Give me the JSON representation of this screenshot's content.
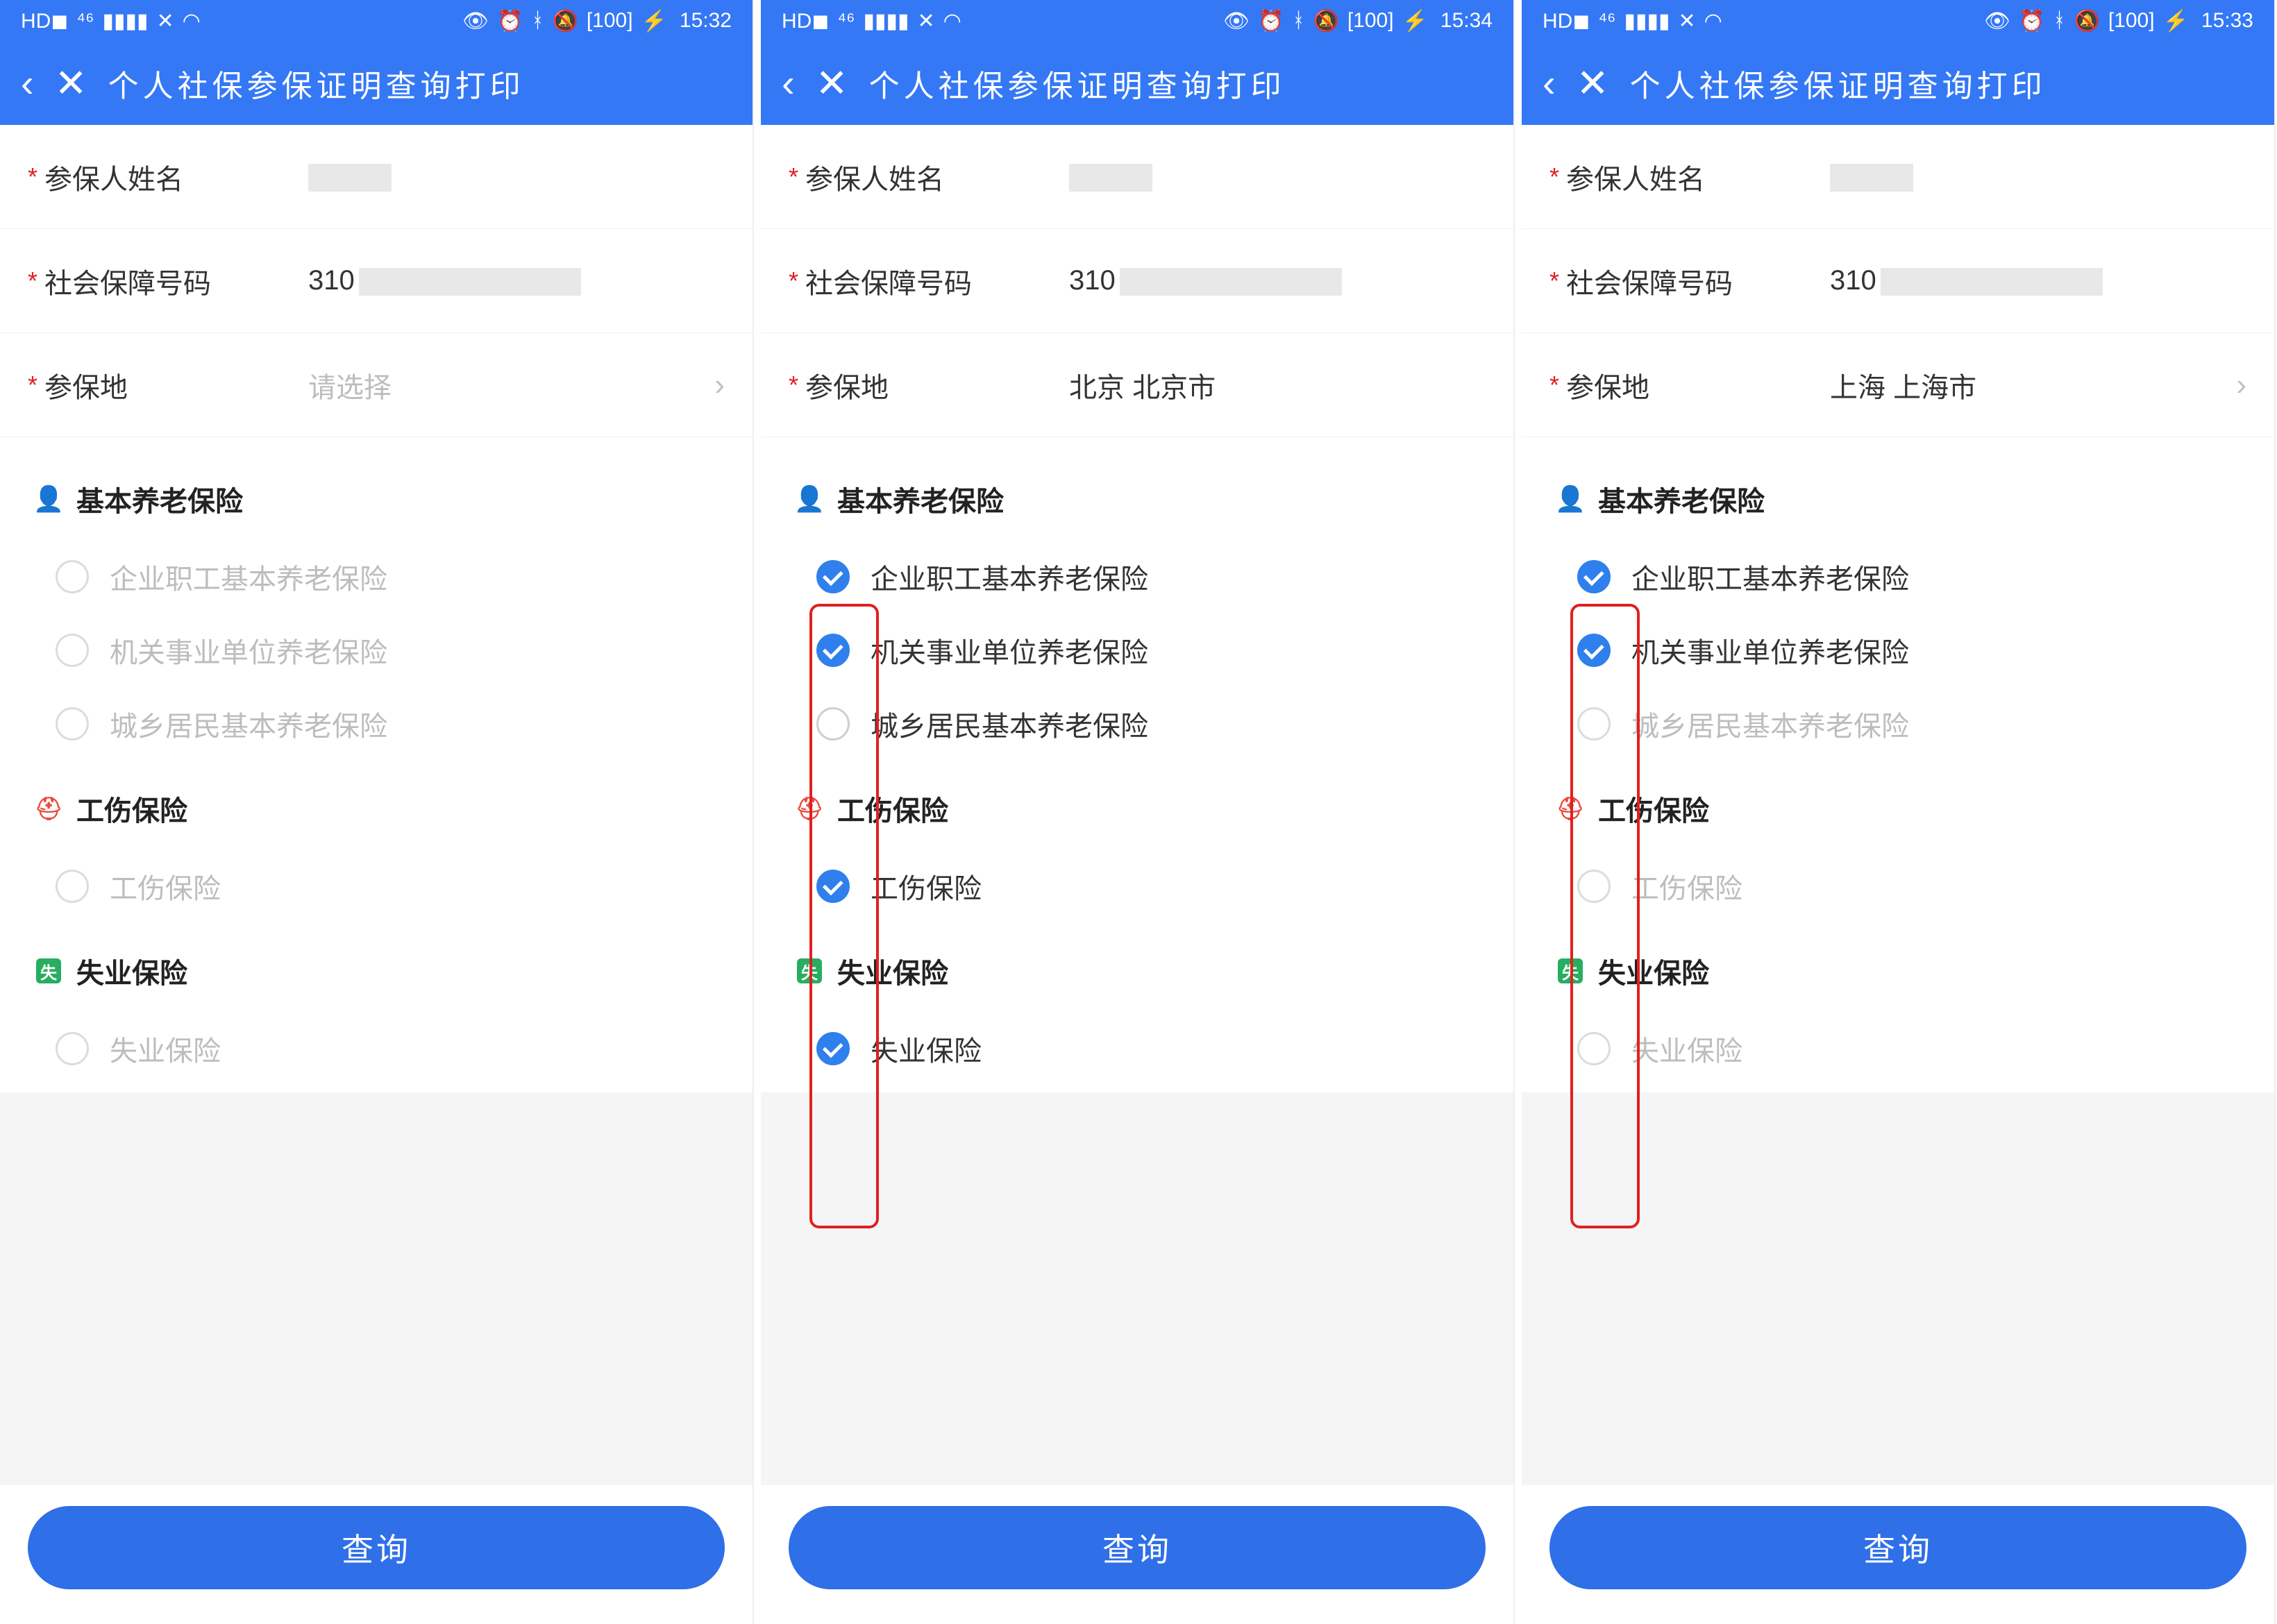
{
  "screens": [
    {
      "status": {
        "time": "15:32",
        "battery": "100"
      },
      "title": "个人社保参保证明查询打印",
      "form": {
        "name_label": "参保人姓名",
        "name_value": "",
        "ssn_label": "社会保障号码",
        "ssn_value": "310",
        "loc_label": "参保地",
        "loc_value": "请选择",
        "loc_is_placeholder": true,
        "show_chevron": true
      },
      "sections": {
        "pension": {
          "title": "基本养老保险",
          "options": [
            {
              "label": "企业职工基本养老保险",
              "checked": false,
              "disabled": true
            },
            {
              "label": "机关事业单位养老保险",
              "checked": false,
              "disabled": true
            },
            {
              "label": "城乡居民基本养老保险",
              "checked": false,
              "disabled": true
            }
          ]
        },
        "injury": {
          "title": "工伤保险",
          "options": [
            {
              "label": "工伤保险",
              "checked": false,
              "disabled": true
            }
          ]
        },
        "unemployment": {
          "title": "失业保险",
          "options": [
            {
              "label": "失业保险",
              "checked": false,
              "disabled": true
            }
          ]
        }
      },
      "button": "查询",
      "redbox": false
    },
    {
      "status": {
        "time": "15:34",
        "battery": "100"
      },
      "title": "个人社保参保证明查询打印",
      "form": {
        "name_label": "参保人姓名",
        "name_value": "",
        "ssn_label": "社会保障号码",
        "ssn_value": "310",
        "loc_label": "参保地",
        "loc_value": "北京 北京市",
        "loc_is_placeholder": false,
        "show_chevron": false
      },
      "sections": {
        "pension": {
          "title": "基本养老保险",
          "options": [
            {
              "label": "企业职工基本养老保险",
              "checked": true,
              "disabled": false
            },
            {
              "label": "机关事业单位养老保险",
              "checked": true,
              "disabled": false
            },
            {
              "label": "城乡居民基本养老保险",
              "checked": false,
              "disabled": false
            }
          ]
        },
        "injury": {
          "title": "工伤保险",
          "options": [
            {
              "label": "工伤保险",
              "checked": true,
              "disabled": false
            }
          ]
        },
        "unemployment": {
          "title": "失业保险",
          "options": [
            {
              "label": "失业保险",
              "checked": true,
              "disabled": false
            }
          ]
        }
      },
      "button": "查询",
      "redbox": true
    },
    {
      "status": {
        "time": "15:33",
        "battery": "100"
      },
      "title": "个人社保参保证明查询打印",
      "form": {
        "name_label": "参保人姓名",
        "name_value": "",
        "ssn_label": "社会保障号码",
        "ssn_value": "310",
        "loc_label": "参保地",
        "loc_value": "上海 上海市",
        "loc_is_placeholder": false,
        "show_chevron": true
      },
      "sections": {
        "pension": {
          "title": "基本养老保险",
          "options": [
            {
              "label": "企业职工基本养老保险",
              "checked": true,
              "disabled": false
            },
            {
              "label": "机关事业单位养老保险",
              "checked": true,
              "disabled": false
            },
            {
              "label": "城乡居民基本养老保险",
              "checked": false,
              "disabled": true
            }
          ]
        },
        "injury": {
          "title": "工伤保险",
          "options": [
            {
              "label": "工伤保险",
              "checked": false,
              "disabled": true
            }
          ]
        },
        "unemployment": {
          "title": "失业保险",
          "options": [
            {
              "label": "失业保险",
              "checked": false,
              "disabled": true
            }
          ]
        }
      },
      "button": "查询",
      "redbox": true
    }
  ],
  "icons": {
    "pension_glyph": "👤",
    "injury_glyph": "⛑",
    "unemployment_glyph": "失"
  }
}
